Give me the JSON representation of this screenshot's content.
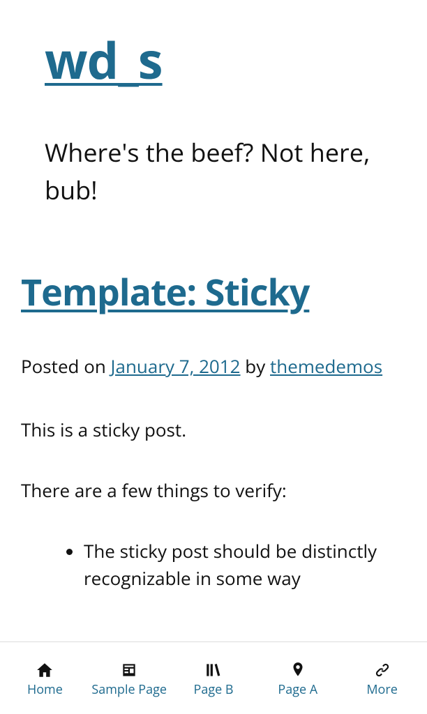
{
  "header": {
    "site_title": "wd_s",
    "tagline": "Where's the beef? Not here, bub!"
  },
  "post": {
    "title": "Template: Sticky",
    "meta": {
      "posted_on_label": "Posted on ",
      "date": "January 7, 2012",
      "by_label": " by ",
      "author": "themedemos"
    },
    "paragraphs": [
      "This is a sticky post.",
      "There are a few things to verify:"
    ],
    "list_items": [
      "The sticky post should be distinctly recognizable in some way"
    ]
  },
  "tabs": [
    {
      "label": "Home",
      "icon": "home-icon"
    },
    {
      "label": "Sample Page",
      "icon": "newspaper-icon"
    },
    {
      "label": "Page B",
      "icon": "books-icon"
    },
    {
      "label": "Page A",
      "icon": "pin-icon"
    },
    {
      "label": "More",
      "icon": "link-icon"
    }
  ]
}
